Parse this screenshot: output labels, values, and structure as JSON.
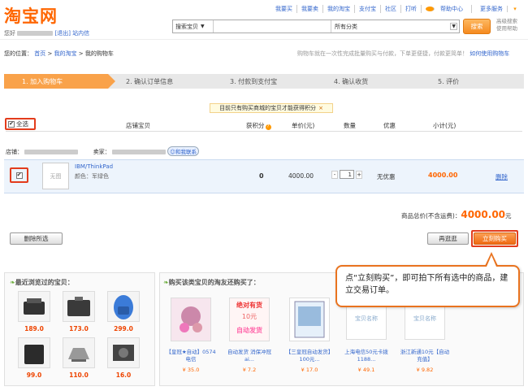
{
  "header": {
    "logo": "淘宝网",
    "welcome_prefix": "您好",
    "logout": "[退出]",
    "inbox": "站内信",
    "top_links": [
      "我要买",
      "我要卖",
      "我的淘宝",
      "支付宝",
      "社区",
      "打听"
    ],
    "help": "帮助中心",
    "more": "更多服务",
    "search_scope": "搜索宝贝",
    "search_value": "",
    "category": "所有分类",
    "search_button": "搜索",
    "adv_search": "高级搜索",
    "usage_help": "使用帮助"
  },
  "breadcrumb": {
    "prefix": "您的位置：",
    "home": "首页",
    "my_taobao": "我的淘宝",
    "current": "我的购物车"
  },
  "tip": {
    "text": "购物车就在一次性完成批量购买与付款，下单更便捷，付款更简单！",
    "link": "如何使用购物车"
  },
  "steps": [
    "1. 加入购物车",
    "2. 确认订单信息",
    "3. 付款到支付宝",
    "4. 确认收货",
    "5. 评价"
  ],
  "notice": "目前只有购买商城的宝贝才能获得积分",
  "notice_close": "×",
  "table": {
    "select_all": "全选",
    "check": "✔",
    "headers": {
      "item": "店铺宝贝",
      "points": "获积分",
      "unit_price": "单价(元)",
      "qty": "数量",
      "discount": "优惠",
      "subtotal": "小计(元)"
    }
  },
  "shop": {
    "shop_label": "店铺：",
    "seller_label": "卖家：",
    "contact": "和我联系"
  },
  "item": {
    "no_image": "无图",
    "name": "IBM/ThinkPad",
    "color": "颜色：军绿色",
    "points": "0",
    "price": "4000.00",
    "qty": "1",
    "minus": "-",
    "plus": "+",
    "discount": "无优惠",
    "subtotal": "4000.00",
    "delete": "删除"
  },
  "total": {
    "label": "商品总价(不含运费)：",
    "value": "4000.00",
    "unit": "元"
  },
  "buttons": {
    "delete_selected": "删除所选",
    "continue": "再逛逛",
    "buy_now": "立刻购买"
  },
  "recent": {
    "title": "最近浏览过的宝贝：",
    "prices": [
      "189.0",
      "173.0",
      "299.0",
      "99.0",
      "110.0",
      "16.0"
    ]
  },
  "recommend": {
    "title": "购买该类宝贝的淘友还购买了：",
    "items": [
      {
        "title": "【皇冠★自动】0574电信",
        "price": "¥ 35.0"
      },
      {
        "title": "自动发货 消保冲冠 ai...",
        "price": "¥ 7.2"
      },
      {
        "title": "【三皇冠自动发货】100元...",
        "price": "¥ 17.0"
      },
      {
        "title": "上海电信50元卡拨1188...",
        "price": "¥ 49.1"
      },
      {
        "title": "浙江新通10元【自动充值】",
        "price": "¥ 9.82"
      }
    ],
    "placeholder_name": "宝贝名称",
    "banner_text1": "绝对有货",
    "banner_text2": "10元",
    "banner_text3": "自动发货"
  },
  "callout": "点“立刻购买”，即可拍下所有选中的商品，建立交易订单。",
  "colors": {
    "accent": "#f58a1f",
    "price": "#e40",
    "callout_border": "#e9731f",
    "highlight": "#e33c1c"
  }
}
